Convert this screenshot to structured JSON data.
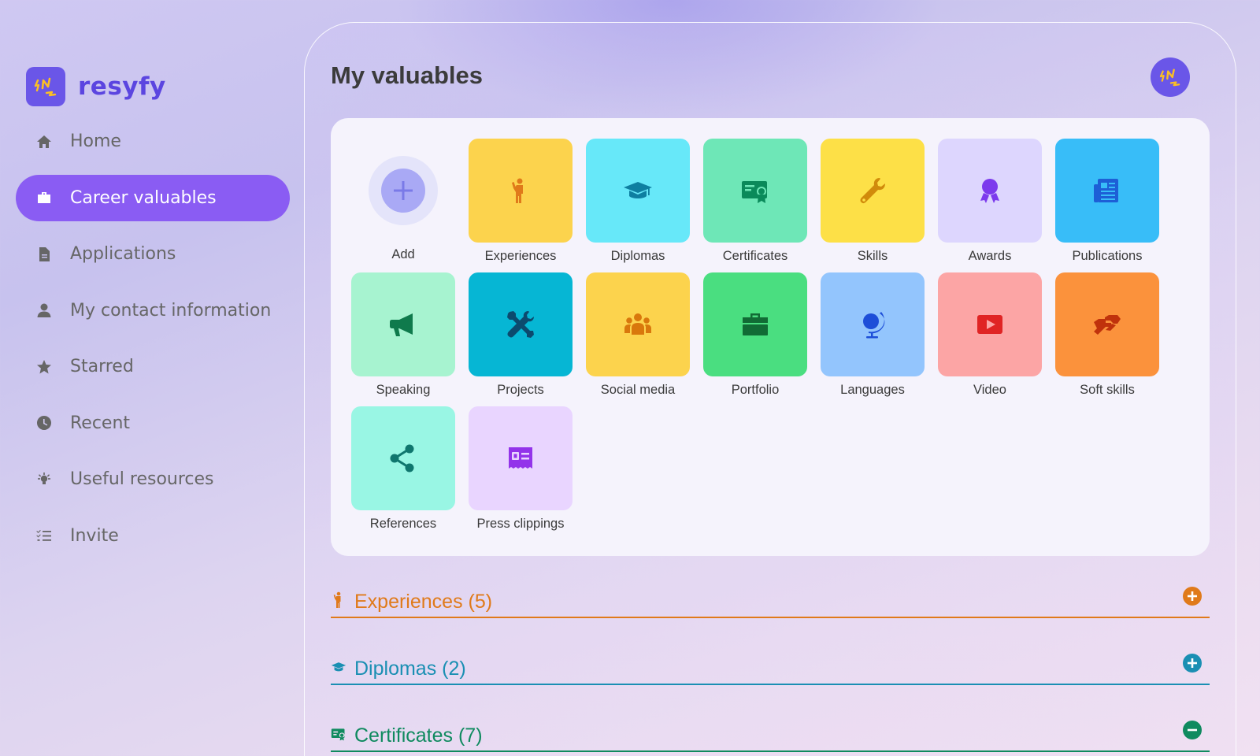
{
  "brand": {
    "name": "resyfy",
    "color": "#5b45e0",
    "logo_bg": "#6a56e8"
  },
  "nav": [
    {
      "label": "Home",
      "icon": "home-icon",
      "active": false
    },
    {
      "label": "Career valuables",
      "icon": "briefcase-icon",
      "active": true
    },
    {
      "label": "Applications",
      "icon": "document-icon",
      "active": false
    },
    {
      "label": "My contact information",
      "icon": "user-icon",
      "active": false
    },
    {
      "label": "Starred",
      "icon": "star-icon",
      "active": false
    },
    {
      "label": "Recent",
      "icon": "clock-icon",
      "active": false
    },
    {
      "label": "Useful resources",
      "icon": "lightbulb-icon",
      "active": false
    },
    {
      "label": "Invite",
      "icon": "checklist-icon",
      "active": false
    }
  ],
  "page": {
    "title": "My valuables"
  },
  "tiles": [
    {
      "label": "Add",
      "icon": "plus-icon"
    },
    {
      "label": "Experiences",
      "icon": "person-icon",
      "bg": "#fcd34d",
      "fg": "#e07a1a"
    },
    {
      "label": "Diplomas",
      "icon": "graduation-cap-icon",
      "bg": "#67e8f9",
      "fg": "#0e7fa1"
    },
    {
      "label": "Certificates",
      "icon": "certificate-icon",
      "bg": "#6ee7b7",
      "fg": "#0a8a5a"
    },
    {
      "label": "Skills",
      "icon": "wrench-icon",
      "bg": "#fde047",
      "fg": "#d18b0b"
    },
    {
      "label": "Awards",
      "icon": "award-icon",
      "bg": "#ddd6fe",
      "fg": "#7c3aed"
    },
    {
      "label": "Publications",
      "icon": "newspaper-icon",
      "bg": "#38bdf8",
      "fg": "#1d5fd6"
    },
    {
      "label": "Speaking",
      "icon": "megaphone-icon",
      "bg": "#a7f3d0",
      "fg": "#0f7a4c"
    },
    {
      "label": "Projects",
      "icon": "tools-icon",
      "bg": "#06b6d4",
      "fg": "#0c4a6e"
    },
    {
      "label": "Social media",
      "icon": "people-icon",
      "bg": "#fcd34d",
      "fg": "#d9780c"
    },
    {
      "label": "Portfolio",
      "icon": "briefcase-icon",
      "bg": "#4ade80",
      "fg": "#116b35"
    },
    {
      "label": "Languages",
      "icon": "globe-icon",
      "bg": "#93c5fd",
      "fg": "#1d4ed8"
    },
    {
      "label": "Video",
      "icon": "video-icon",
      "bg": "#fca5a5",
      "fg": "#e02424"
    },
    {
      "label": "Soft skills",
      "icon": "handshake-icon",
      "bg": "#fb923c",
      "fg": "#c0320c"
    },
    {
      "label": "References",
      "icon": "share-icon",
      "bg": "#99f6e4",
      "fg": "#0f766e"
    },
    {
      "label": "Press clippings",
      "icon": "press-icon",
      "bg": "#e9d5ff",
      "fg": "#9333ea"
    }
  ],
  "sections": [
    {
      "title": "Experiences (5)",
      "icon": "person-icon",
      "color": "#e07a1a",
      "toggle": "expand"
    },
    {
      "title": "Diplomas (2)",
      "icon": "graduation-cap-icon",
      "color": "#1a8fb3",
      "toggle": "expand"
    },
    {
      "title": "Certificates (7)",
      "icon": "certificate-icon",
      "color": "#0f8a5f",
      "toggle": "collapse"
    }
  ]
}
